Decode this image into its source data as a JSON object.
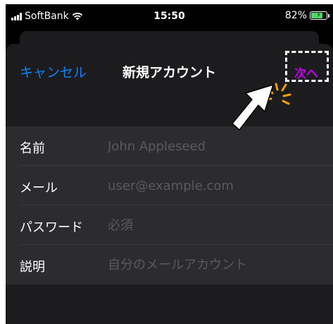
{
  "status_bar": {
    "carrier": "SoftBank",
    "time": "15:50",
    "battery": "82%",
    "battery_level": 0.82
  },
  "nav": {
    "cancel_label": "キャンセル",
    "title": "新規アカウント",
    "next_label": "次へ"
  },
  "form": {
    "rows": [
      {
        "label": "名前",
        "placeholder": "John Appleseed",
        "value": ""
      },
      {
        "label": "メール",
        "placeholder": "user@example.com",
        "value": ""
      },
      {
        "label": "パスワード",
        "placeholder": "必須",
        "value": ""
      },
      {
        "label": "説明",
        "placeholder": "自分のメールアカウント",
        "value": ""
      }
    ]
  },
  "colors": {
    "accent": "#0a84ff",
    "next_highlight": "#c200e6",
    "annotation_sparkle": "#f5a000",
    "battery_fill": "#4cd964",
    "background": "#000000",
    "sheet": "#1c1c1e",
    "form_bg": "#2c2c2e"
  },
  "icons": {
    "signal": "cellular-signal-icon",
    "wifi": "wifi-icon",
    "battery": "battery-charging-icon",
    "annotation_arrow": "pointer-arrow-icon",
    "annotation_sparkle": "sparkle-icon"
  }
}
